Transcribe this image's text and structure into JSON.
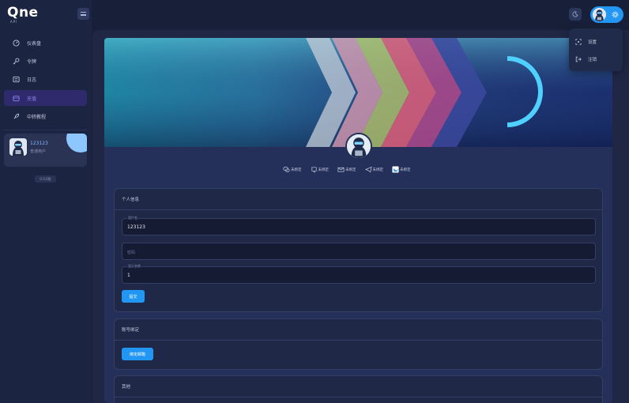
{
  "app": {
    "logo_text": "Qne",
    "logo_sub": "API",
    "version": "0.0.0版"
  },
  "sidebar": {
    "items": [
      {
        "label": "仪表盘",
        "icon": "dashboard-icon",
        "active": false
      },
      {
        "label": "令牌",
        "icon": "key-icon",
        "active": false
      },
      {
        "label": "日志",
        "icon": "log-icon",
        "active": false
      },
      {
        "label": "充值",
        "icon": "wallet-icon",
        "active": true
      },
      {
        "label": "中转教程",
        "icon": "rocket-icon",
        "active": false
      }
    ],
    "user": {
      "name": "123123",
      "role": "普通用户"
    }
  },
  "topbar": {
    "theme_icon": "moon-icon",
    "settings_icon": "gear-icon"
  },
  "dropdown": {
    "items": [
      {
        "label": "设置",
        "icon": "settings-icon"
      },
      {
        "label": "注销",
        "icon": "logout-icon"
      }
    ]
  },
  "bindings": [
    {
      "label": "未绑定",
      "icon": "wechat-icon"
    },
    {
      "label": "未绑定",
      "icon": "github-icon"
    },
    {
      "label": "未绑定",
      "icon": "email-icon"
    },
    {
      "label": "未绑定",
      "icon": "telegram-icon"
    },
    {
      "label": "未绑定",
      "icon": "lark-icon"
    }
  ],
  "personal": {
    "title": "个人信息",
    "username_label": "用户名",
    "username_value": "123123",
    "password_placeholder": "密码",
    "display_label": "显示名称",
    "display_value": "1",
    "submit_label": "提交"
  },
  "account_binding": {
    "title": "账号绑定",
    "bind_email_label": "绑定邮箱"
  },
  "other": {
    "title": "其他"
  },
  "colors": {
    "accent": "#2196f3",
    "active_nav_bg": "#2f2a6b",
    "active_nav_text": "#8d86f5",
    "background": "#182039",
    "card": "#25305a"
  }
}
